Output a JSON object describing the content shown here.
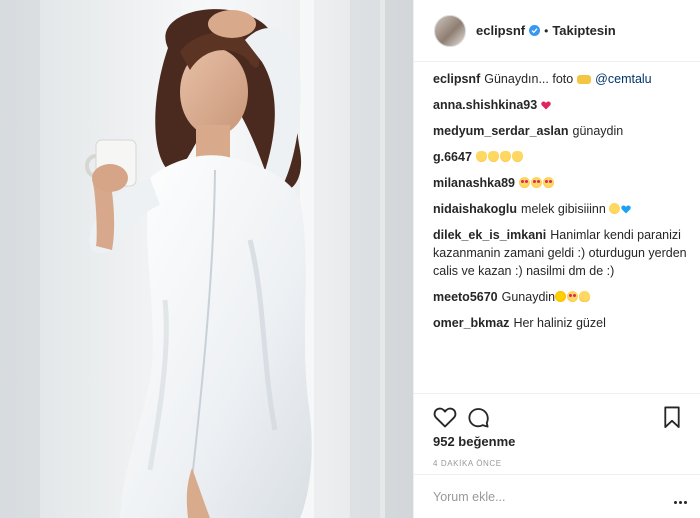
{
  "post": {
    "username": "eclipsnf",
    "follow_status": "Takiptesin",
    "caption": {
      "user": "eclipsnf",
      "text": "Günaydın... foto",
      "mention": "@cemtalu"
    },
    "comments": [
      {
        "user": "anna.shishkina93",
        "text": ""
      },
      {
        "user": "medyum_serdar_aslan",
        "text": "günaydin"
      },
      {
        "user": "g.6647",
        "text": ""
      },
      {
        "user": "milanashka89",
        "text": ""
      },
      {
        "user": "nidaishakoglu",
        "text": "melek gibisiiinn"
      },
      {
        "user": "dilek_ek_is_imkani",
        "text": "Hanimlar kendi paranizi kazanmanin zamani geldi :) oturdugun yerden calis ve kazan :) nasilmi dm de :)"
      },
      {
        "user": "meeto5670",
        "text": "Gunaydin"
      },
      {
        "user": "omer_bkmaz",
        "text": "Her haliniz güzel"
      }
    ],
    "likes": "952 beğenme",
    "timestamp": "4 DAKİKA ÖNCE",
    "comment_placeholder": "Yorum ekle...",
    "icons": [
      "heart-icon",
      "comment-icon",
      "bookmark-icon",
      "more-options-icon",
      "verified-badge-icon"
    ],
    "colors": {
      "verified": "#3897f0",
      "mention_link": "#003569",
      "muted": "#999999",
      "border": "#efefef"
    }
  }
}
